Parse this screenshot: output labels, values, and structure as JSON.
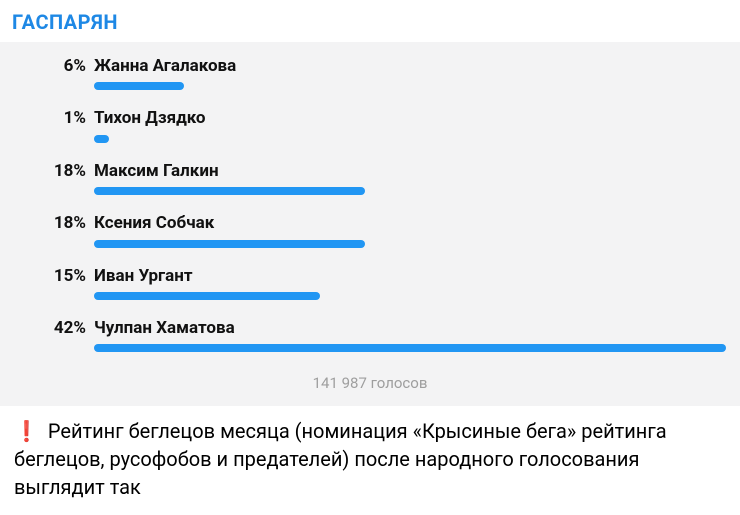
{
  "title": "ГАСПАРЯН",
  "chart_data": {
    "type": "bar",
    "title": "ГАСПАРЯН",
    "categories": [
      "Жанна Агалакова",
      "Тихон Дзядко",
      "Максим Галкин",
      "Ксения Собчак",
      "Иван Ургант",
      "Чулпан Хаматова"
    ],
    "values": [
      6,
      1,
      18,
      18,
      15,
      42
    ],
    "value_unit": "%",
    "xlabel": "",
    "ylabel": "",
    "ylim": [
      0,
      42
    ],
    "total_votes_label": "141 987 голосов"
  },
  "poll": {
    "options": [
      {
        "pct_label": "6%",
        "label": "Жанна Агалакова",
        "value": 6
      },
      {
        "pct_label": "1%",
        "label": "Тихон Дзядко",
        "value": 1
      },
      {
        "pct_label": "18%",
        "label": "Максим Галкин",
        "value": 18
      },
      {
        "pct_label": "18%",
        "label": "Ксения Собчак",
        "value": 18
      },
      {
        "pct_label": "15%",
        "label": "Иван Ургант",
        "value": 15
      },
      {
        "pct_label": "42%",
        "label": "Чулпан Хаматова",
        "value": 42
      }
    ],
    "votes_label": "141 987 голосов",
    "max_value": 42
  },
  "caption": {
    "warn_glyph": "❗",
    "text": "Рейтинг беглецов месяца (номинация «Крысиные бега» рейтинга беглецов, русофобов и предателей) после народного голосования выглядит так"
  }
}
